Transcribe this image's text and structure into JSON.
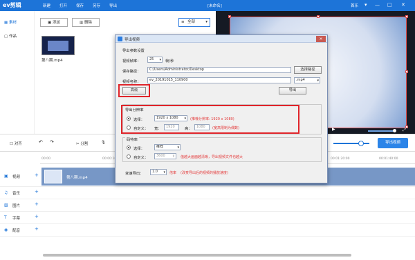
{
  "app": {
    "logo": "ev剪辑",
    "menu": [
      "新建",
      "打开",
      "保存",
      "另存",
      "导出"
    ],
    "document_title": "[未命名]",
    "user": "首乐",
    "window_controls": [
      "▾",
      "—",
      "□",
      "✕"
    ]
  },
  "left_rail": {
    "items": [
      {
        "label": "素材",
        "active": true
      },
      {
        "label": "作品",
        "active": false
      }
    ]
  },
  "media": {
    "add_label": "添加",
    "delete_label": "删除",
    "filter_selected": "全部",
    "clip_name": "第八期.mp4"
  },
  "toolbar": {
    "align_label": "对齐",
    "split_label": "分割",
    "export_label": "导出视频"
  },
  "timeline": {
    "ticks": [
      "00:00",
      "00:00:10:00",
      "00:01:20:00",
      "00:01:40:00"
    ],
    "tracks": [
      "视频",
      "音乐",
      "图片",
      "字幕",
      "配音"
    ],
    "clip_label": "第八期.mp4"
  },
  "dialog": {
    "title": "导出视频",
    "section_params": "导出参数设置",
    "fps_label": "视频帧率：",
    "fps_value": "25",
    "fps_unit": "帧/秒",
    "path_label": "保存路径：",
    "path_value": "C:/Users/Administrator/Desktop",
    "choose_path_label": "选择路径",
    "name_label": "视频名称：",
    "name_value": "ev_20191015_110900",
    "format_value": ".mp4",
    "advanced_label": "高级",
    "export_label": "导出",
    "resolution": {
      "title": "导出分辨率",
      "select_label": "选择：",
      "select_value": "1920 x 1080",
      "recommend_note": "(推荐分辨率: 1920 x 1080)",
      "custom_label": "自定义：",
      "width_label": "宽：",
      "width_value": "1920",
      "height_label": "高：",
      "height_value": "1080",
      "custom_note": "(宽高限制为偶数)"
    },
    "bitrate": {
      "title": "码特率",
      "select_label": "选择：",
      "select_value": "推荐",
      "custom_label": "自定义：",
      "custom_value": "3600",
      "note": "值越大画面越清晰，导出视频文件也越大"
    },
    "speed": {
      "label": "变速导出：",
      "value": "1.0",
      "unit": "倍率",
      "note": "(改变导出后的视频的播放速度)"
    }
  },
  "colors": {
    "brand": "#1d74d8",
    "highlight": "#e0242a"
  }
}
